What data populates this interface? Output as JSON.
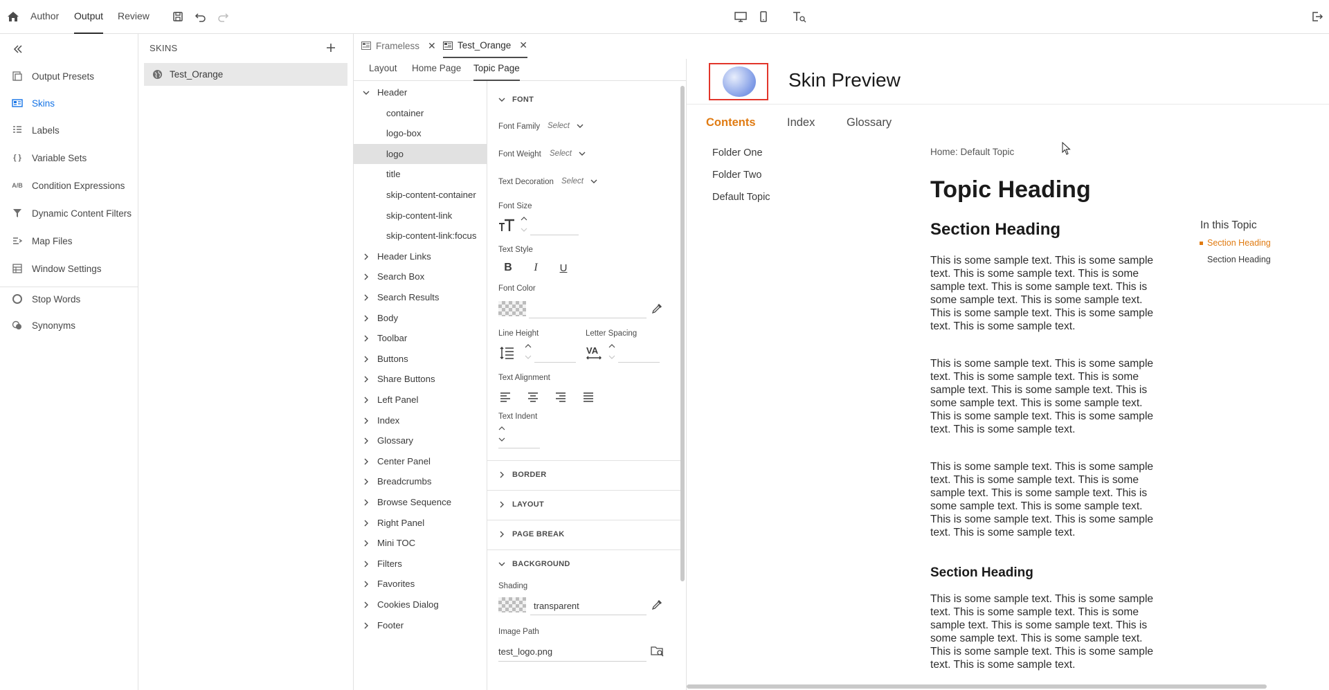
{
  "topbar": {
    "modes": [
      "Author",
      "Output",
      "Review"
    ],
    "active_mode": "Output"
  },
  "leftnav": {
    "items": [
      {
        "label": "Output Presets",
        "icon": "output-presets-icon"
      },
      {
        "label": "Skins",
        "icon": "skins-icon",
        "active": true
      },
      {
        "label": "Labels",
        "icon": "labels-icon"
      },
      {
        "label": "Variable Sets",
        "icon_text": "{ }"
      },
      {
        "label": "Condition Expressions",
        "icon_text": "A/B"
      },
      {
        "label": "Dynamic Content Filters",
        "icon": "filter-icon"
      },
      {
        "label": "Map Files",
        "icon": "map-files-icon"
      },
      {
        "label": "Window Settings",
        "icon": "window-settings-icon"
      },
      {
        "label": "Stop Words",
        "icon": "stop-words-icon"
      },
      {
        "label": "Synonyms",
        "icon": "synonyms-icon"
      }
    ]
  },
  "skins_panel": {
    "title": "SKINS",
    "items": [
      "Test_Orange"
    ]
  },
  "doc_tabs": [
    {
      "label": "Frameless",
      "active": false
    },
    {
      "label": "Test_Orange",
      "active": true
    }
  ],
  "sub_tabs": [
    {
      "label": "Layout"
    },
    {
      "label": "Home Page"
    },
    {
      "label": "Topic Page",
      "active": true
    }
  ],
  "tree": {
    "header": "Header",
    "header_children": [
      "container",
      "logo-box",
      "logo",
      "title",
      "skip-content-container",
      "skip-content-link",
      "skip-content-link:focus"
    ],
    "selected": "logo",
    "groups": [
      "Header Links",
      "Search Box",
      "Search Results",
      "Body",
      "Toolbar",
      "Buttons",
      "Share Buttons",
      "Left Panel",
      "Index",
      "Glossary",
      "Center Panel",
      "Breadcrumbs",
      "Browse Sequence",
      "Right Panel",
      "Mini TOC",
      "Filters",
      "Favorites",
      "Cookies Dialog",
      "Footer"
    ]
  },
  "props": {
    "font_section": "FONT",
    "font_family_label": "Font Family",
    "font_weight_label": "Font Weight",
    "text_decoration_label": "Text Decoration",
    "select_placeholder": "Select",
    "font_size_label": "Font Size",
    "text_style_label": "Text Style",
    "bold": "B",
    "italic": "I",
    "underline": "U",
    "font_color_label": "Font Color",
    "line_height_label": "Line Height",
    "letter_spacing_label": "Letter Spacing",
    "text_alignment_label": "Text Alignment",
    "text_indent_label": "Text Indent",
    "border_section": "BORDER",
    "layout_section": "LAYOUT",
    "page_break_section": "PAGE BREAK",
    "background_section": "BACKGROUND",
    "shading_label": "Shading",
    "shading_value": "transparent",
    "image_path_label": "Image Path",
    "image_path_value": "test_logo.png"
  },
  "preview": {
    "title": "Skin Preview",
    "tabs": [
      "Contents",
      "Index",
      "Glossary"
    ],
    "active_tab": "Contents",
    "nav": [
      "Folder One",
      "Folder Two",
      "Default Topic"
    ],
    "breadcrumb": "Home: Default Topic",
    "topic_heading": "Topic Heading",
    "section_heading": "Section Heading",
    "paragraph": "This is some sample text. This is some sample text. This is some sample text. This is some sample text. This is some sample text. This is some sample text. This is some sample text. This is some sample text. This is some sample text. This is some sample text.",
    "mini_toc_title": "In this Topic",
    "mini_toc": [
      "Section Heading",
      "Section Heading"
    ]
  },
  "colors": {
    "accent_blue": "#1473e6",
    "preview_orange": "#e07b12",
    "logo_box_red": "#e2352a"
  }
}
